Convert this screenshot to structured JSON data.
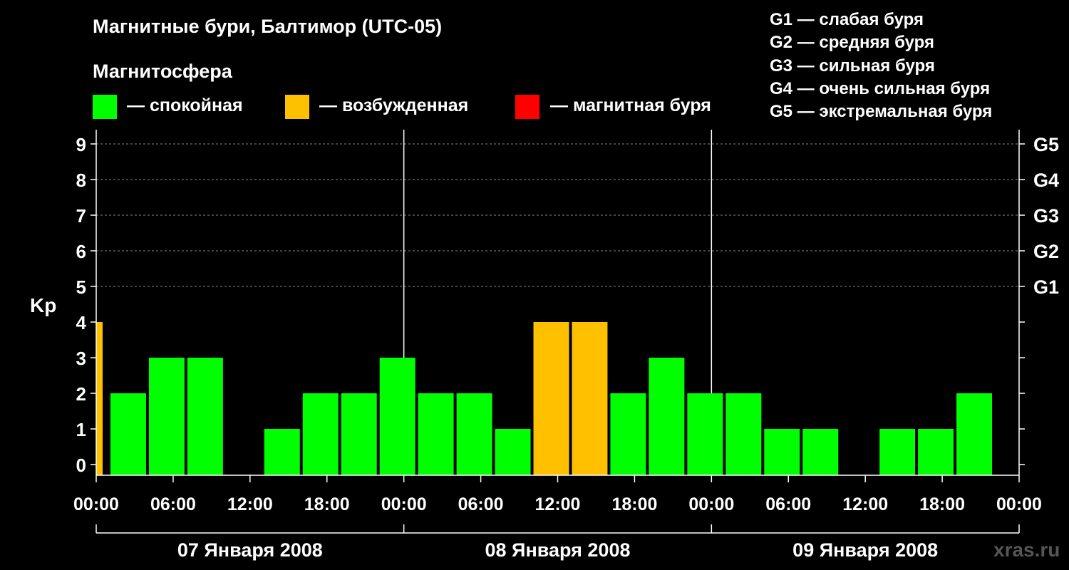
{
  "title": "Магнитные бури, Балтимор (UTC-05)",
  "legend": {
    "title": "Магнитосфера",
    "items": [
      {
        "label": "— спокойная",
        "color": "#00ff00"
      },
      {
        "label": "— возбужденная",
        "color": "#ffc000"
      },
      {
        "label": "— магнитная буря",
        "color": "#ff0000"
      }
    ]
  },
  "g_scale": [
    "G1 — слабая буря",
    "G2 — средняя буря",
    "G3 — сильная буря",
    "G4 — очень сильная буря",
    "G5 — экстремальная буря"
  ],
  "watermark": "xras.ru",
  "chart_data": {
    "type": "bar",
    "ylabel": "Kp",
    "ylim": [
      0,
      9
    ],
    "y_ticks": [
      "0",
      "1",
      "2",
      "3",
      "4",
      "5",
      "6",
      "7",
      "8",
      "9"
    ],
    "g_ticks": [
      {
        "kp": 5,
        "label": "G1"
      },
      {
        "kp": 6,
        "label": "G2"
      },
      {
        "kp": 7,
        "label": "G3"
      },
      {
        "kp": 8,
        "label": "G4"
      },
      {
        "kp": 9,
        "label": "G5"
      }
    ],
    "x_tick_labels": [
      "00:00",
      "06:00",
      "12:00",
      "18:00",
      "00:00",
      "06:00",
      "12:00",
      "18:00",
      "00:00",
      "06:00",
      "12:00",
      "18:00",
      "00:00"
    ],
    "days": [
      "07 Января 2008",
      "08 Января 2008",
      "09 Января 2008"
    ],
    "hours_total": 72,
    "colors": {
      "quiet": "#00ff00",
      "active": "#ffc000",
      "storm": "#ff0000"
    },
    "bars": [
      {
        "start_hour": 0,
        "end_hour": 0.5,
        "kp": 4,
        "level": "active"
      },
      {
        "start_hour": 1,
        "end_hour": 4,
        "kp": 2,
        "level": "quiet"
      },
      {
        "start_hour": 4,
        "end_hour": 7,
        "kp": 3,
        "level": "quiet"
      },
      {
        "start_hour": 7,
        "end_hour": 10,
        "kp": 3,
        "level": "quiet"
      },
      {
        "start_hour": 10,
        "end_hour": 13,
        "kp": 0,
        "level": "quiet"
      },
      {
        "start_hour": 13,
        "end_hour": 16,
        "kp": 1,
        "level": "quiet"
      },
      {
        "start_hour": 16,
        "end_hour": 19,
        "kp": 2,
        "level": "quiet"
      },
      {
        "start_hour": 19,
        "end_hour": 22,
        "kp": 2,
        "level": "quiet"
      },
      {
        "start_hour": 22,
        "end_hour": 25,
        "kp": 3,
        "level": "quiet"
      },
      {
        "start_hour": 25,
        "end_hour": 28,
        "kp": 2,
        "level": "quiet"
      },
      {
        "start_hour": 28,
        "end_hour": 31,
        "kp": 2,
        "level": "quiet"
      },
      {
        "start_hour": 31,
        "end_hour": 34,
        "kp": 1,
        "level": "quiet"
      },
      {
        "start_hour": 34,
        "end_hour": 37,
        "kp": 4,
        "level": "active"
      },
      {
        "start_hour": 37,
        "end_hour": 40,
        "kp": 4,
        "level": "active"
      },
      {
        "start_hour": 40,
        "end_hour": 43,
        "kp": 2,
        "level": "quiet"
      },
      {
        "start_hour": 43,
        "end_hour": 46,
        "kp": 3,
        "level": "quiet"
      },
      {
        "start_hour": 46,
        "end_hour": 49,
        "kp": 2,
        "level": "quiet"
      },
      {
        "start_hour": 49,
        "end_hour": 52,
        "kp": 2,
        "level": "quiet"
      },
      {
        "start_hour": 52,
        "end_hour": 55,
        "kp": 1,
        "level": "quiet"
      },
      {
        "start_hour": 55,
        "end_hour": 58,
        "kp": 1,
        "level": "quiet"
      },
      {
        "start_hour": 58,
        "end_hour": 61,
        "kp": 0,
        "level": "quiet"
      },
      {
        "start_hour": 61,
        "end_hour": 64,
        "kp": 1,
        "level": "quiet"
      },
      {
        "start_hour": 64,
        "end_hour": 67,
        "kp": 1,
        "level": "quiet"
      },
      {
        "start_hour": 67,
        "end_hour": 70,
        "kp": 2,
        "level": "quiet"
      }
    ],
    "grid": "dashed horizontal at Kp 5–9"
  }
}
